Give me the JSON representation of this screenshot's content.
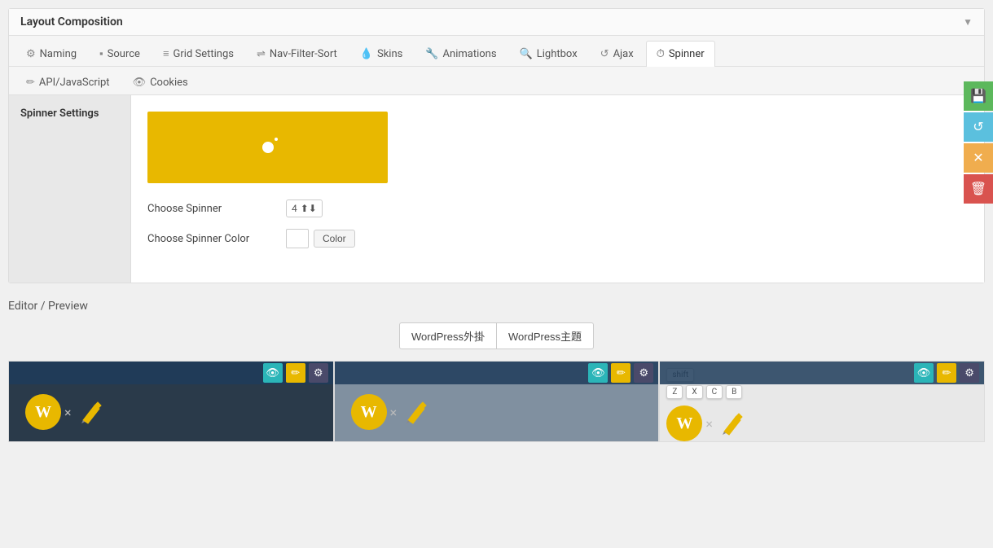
{
  "panel": {
    "title": "Layout Composition",
    "collapse_icon": "▼"
  },
  "tabs": {
    "row1": [
      {
        "id": "naming",
        "icon": "⚙",
        "label": "Naming"
      },
      {
        "id": "source",
        "icon": "▪",
        "label": "Source"
      },
      {
        "id": "grid-settings",
        "icon": "≡",
        "label": "Grid Settings"
      },
      {
        "id": "nav-filter-sort",
        "icon": "⇌",
        "label": "Nav-Filter-Sort"
      },
      {
        "id": "skins",
        "icon": "💧",
        "label": "Skins"
      },
      {
        "id": "animations",
        "icon": "🔧",
        "label": "Animations"
      },
      {
        "id": "lightbox",
        "icon": "🔍",
        "label": "Lightbox"
      },
      {
        "id": "ajax",
        "icon": "↺",
        "label": "Ajax"
      },
      {
        "id": "spinner",
        "icon": "⏱",
        "label": "Spinner",
        "active": true
      }
    ],
    "row2": [
      {
        "id": "api-javascript",
        "icon": "✏",
        "label": "API/JavaScript"
      },
      {
        "id": "cookies",
        "icon": "👁",
        "label": "Cookies"
      }
    ]
  },
  "sidebar": {
    "label": "Spinner Settings"
  },
  "spinner_settings": {
    "choose_spinner_label": "Choose Spinner",
    "spinner_value": "4",
    "choose_color_label": "Choose Spinner Color",
    "color_button_label": "Color"
  },
  "action_buttons": [
    {
      "id": "save",
      "icon": "💾",
      "color": "green",
      "title": "Save"
    },
    {
      "id": "refresh",
      "icon": "↺",
      "color": "blue",
      "title": "Refresh"
    },
    {
      "id": "warning",
      "icon": "✕",
      "color": "yellow",
      "title": "Warning"
    },
    {
      "id": "delete",
      "icon": "🗑",
      "color": "red",
      "title": "Delete"
    }
  ],
  "editor": {
    "title": "Editor / Preview",
    "filter_buttons": [
      {
        "id": "wordpress-plugins",
        "label": "WordPress外掛"
      },
      {
        "id": "wordpress-themes",
        "label": "WordPress主題"
      }
    ]
  },
  "grid_items": [
    {
      "id": "item1",
      "bg_class": "dark-bg",
      "wp_color": "#e8b800"
    },
    {
      "id": "item2",
      "bg_class": "medium-bg",
      "wp_color": "#e8b800"
    },
    {
      "id": "item3",
      "bg_class": "keyboard",
      "wp_color": "#e8b800",
      "keys": [
        [
          "shift"
        ],
        [
          "Z",
          "X",
          "C",
          "B"
        ]
      ]
    }
  ],
  "colors": {
    "spinner_bg": "#e8b800",
    "overlay_bg": "#1e3c5a",
    "teal": "#2bb5b8",
    "action_green": "#5cb85c",
    "action_blue": "#5bc0de",
    "action_yellow": "#f0ad4e",
    "action_red": "#d9534f"
  }
}
